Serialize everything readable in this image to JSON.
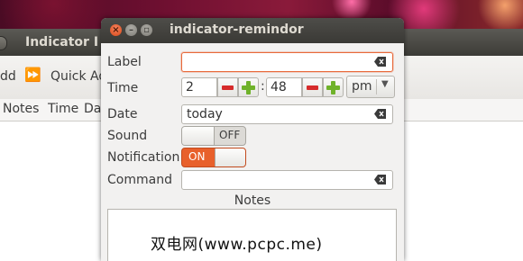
{
  "main_window": {
    "title": "Indicator I",
    "toolbar": {
      "add_label": "dd",
      "quick_add_label": "Quick Ad"
    },
    "columns": [
      "Notes",
      "Time",
      "Da"
    ]
  },
  "dialog": {
    "title": "indicator-remindor",
    "labels": {
      "label": "Label",
      "time": "Time",
      "date": "Date",
      "sound": "Sound",
      "notification": "Notification",
      "command": "Command",
      "notes": "Notes"
    },
    "label_value": "",
    "time": {
      "hour": "2",
      "colon": ":",
      "minute": "48",
      "ampm": "pm"
    },
    "date_value": "today",
    "sound_switch": {
      "text": "OFF",
      "state": "off"
    },
    "notification_switch": {
      "text": "ON",
      "state": "on"
    },
    "command_value": "",
    "notes_value": ""
  },
  "watermark": "双电网(www.pcpc.me)",
  "colors": {
    "accent": "#e8602b",
    "minus": "#d62b2b",
    "plus": "#6fb22a",
    "titlebar": "#3c3b37"
  }
}
